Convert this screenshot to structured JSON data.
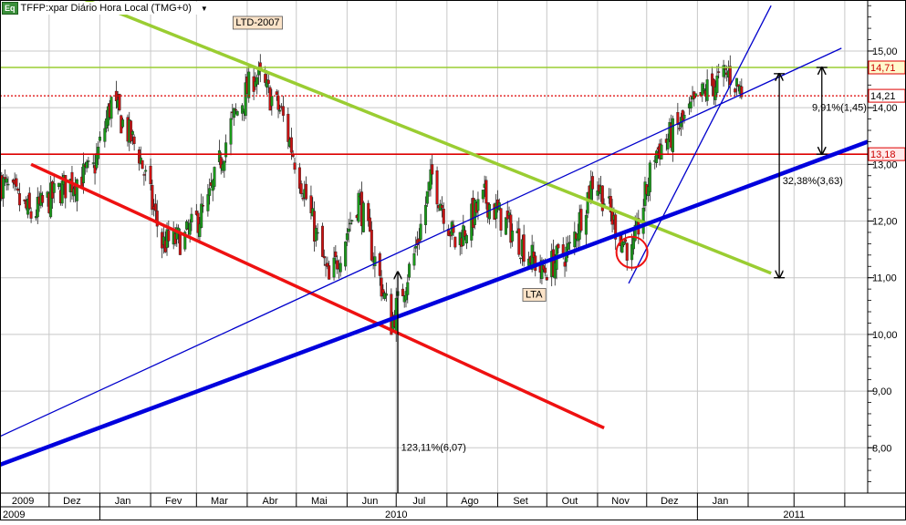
{
  "header": {
    "icon_label": "Eq",
    "title": "TFFP:xpar Diário Hora Local (TMG+0)",
    "dropdown_glyph": "▼"
  },
  "chart_data": {
    "type": "candlestick",
    "y_axis": {
      "position": "right",
      "range": [
        7.2,
        15.9
      ],
      "ticks": [
        "8,00",
        "9,00",
        "10,00",
        "11,00",
        "12,00",
        "13,00",
        "14,00",
        "15,00"
      ],
      "tick_values": [
        8,
        9,
        10,
        11,
        12,
        13,
        14,
        15
      ]
    },
    "x_axis": {
      "months": [
        {
          "label": "2009",
          "date": "2009-11-15"
        },
        {
          "label": "Dez",
          "date": "2009-12-15"
        },
        {
          "label": "Jan",
          "date": "2010-01-15"
        },
        {
          "label": "Fev",
          "date": "2010-02-15"
        },
        {
          "label": "Mar",
          "date": "2010-03-15"
        },
        {
          "label": "Abr",
          "date": "2010-04-15"
        },
        {
          "label": "Mai",
          "date": "2010-05-15"
        },
        {
          "label": "Jun",
          "date": "2010-06-15"
        },
        {
          "label": "Jul",
          "date": "2010-07-15"
        },
        {
          "label": "Ago",
          "date": "2010-08-15"
        },
        {
          "label": "Set",
          "date": "2010-09-15"
        },
        {
          "label": "Out",
          "date": "2010-10-15"
        },
        {
          "label": "Nov",
          "date": "2010-11-15"
        },
        {
          "label": "Dez",
          "date": "2010-12-15"
        },
        {
          "label": "Jan",
          "date": "2011-01-15"
        }
      ],
      "years": [
        {
          "label": "2009",
          "date": "2009-12-01"
        },
        {
          "label": "2010",
          "date": "2010-07-01"
        },
        {
          "label": "2011",
          "date": "2011-03-01"
        }
      ],
      "range": [
        "2009-11-01",
        "2011-04-15"
      ]
    },
    "price_anchors": [
      {
        "date": "2009-11-01",
        "close": 12.7
      },
      {
        "date": "2009-11-20",
        "close": 12.1
      },
      {
        "date": "2009-12-10",
        "close": 12.6
      },
      {
        "date": "2009-12-28",
        "close": 12.9
      },
      {
        "date": "2010-01-08",
        "close": 14.1
      },
      {
        "date": "2010-01-25",
        "close": 13.2
      },
      {
        "date": "2010-02-08",
        "close": 11.6
      },
      {
        "date": "2010-02-22",
        "close": 11.7
      },
      {
        "date": "2010-03-08",
        "close": 12.3
      },
      {
        "date": "2010-03-22",
        "close": 13.7
      },
      {
        "date": "2010-04-06",
        "close": 14.6
      },
      {
        "date": "2010-04-22",
        "close": 13.9
      },
      {
        "date": "2010-05-06",
        "close": 12.5
      },
      {
        "date": "2010-05-21",
        "close": 10.9
      },
      {
        "date": "2010-06-08",
        "close": 12.4
      },
      {
        "date": "2010-06-28",
        "close": 10.2
      },
      {
        "date": "2010-07-12",
        "close": 11.4
      },
      {
        "date": "2010-07-23",
        "close": 12.8
      },
      {
        "date": "2010-08-06",
        "close": 11.6
      },
      {
        "date": "2010-08-24",
        "close": 12.4
      },
      {
        "date": "2010-09-08",
        "close": 11.9
      },
      {
        "date": "2010-09-28",
        "close": 11.1
      },
      {
        "date": "2010-10-15",
        "close": 11.5
      },
      {
        "date": "2010-10-30",
        "close": 12.8
      },
      {
        "date": "2010-11-12",
        "close": 11.9
      },
      {
        "date": "2010-11-22",
        "close": 11.4
      },
      {
        "date": "2010-12-06",
        "close": 13.2
      },
      {
        "date": "2010-12-22",
        "close": 13.7
      },
      {
        "date": "2011-01-06",
        "close": 14.3
      },
      {
        "date": "2011-01-20",
        "close": 14.6
      },
      {
        "date": "2011-01-28",
        "close": 14.3
      }
    ],
    "horizontal_lines": [
      {
        "value": 14.71,
        "label": "14,71",
        "color": "#9acd32",
        "style": "solid"
      },
      {
        "value": 14.21,
        "label": "14,21",
        "color": "#dd0000",
        "style": "dotted"
      },
      {
        "value": 13.18,
        "label": "13,18",
        "color": "#dd0000",
        "style": "solid"
      }
    ],
    "trend_lines": [
      {
        "name": "LTD-2007",
        "color": "#9acd32",
        "from": {
          "date": "2009-12-15",
          "value": 16.0
        },
        "to": {
          "date": "2011-02-15",
          "value": 11.08
        }
      },
      {
        "name": "red-downtrend",
        "color": "#ee1111",
        "from": {
          "date": "2009-11-20",
          "value": 13.0
        },
        "to": {
          "date": "2010-11-05",
          "value": 8.35
        }
      },
      {
        "name": "LTA",
        "color": "#0000dd",
        "from": {
          "date": "2009-11-01",
          "value": 7.7
        },
        "to": {
          "date": "2011-04-15",
          "value": 13.4
        }
      },
      {
        "name": "upper-channel",
        "color": "#0000cc",
        "from": {
          "date": "2009-11-01",
          "value": 8.2
        },
        "to": {
          "date": "2011-03-30",
          "value": 15.05
        }
      },
      {
        "name": "steep-up",
        "color": "#0000cc",
        "from": {
          "date": "2010-11-20",
          "value": 10.9
        },
        "to": {
          "date": "2011-02-15",
          "value": 15.8
        }
      }
    ],
    "annotations": [
      {
        "text": "LTD-2007",
        "date": "2010-03-25",
        "value": 15.45,
        "box": true
      },
      {
        "text": "LTA",
        "date": "2010-09-18",
        "value": 10.65,
        "box": true
      },
      {
        "text": "9,91%(1,45)",
        "date": "2011-03-12",
        "value": 13.95,
        "box": false
      },
      {
        "text": "32,38%(3,63)",
        "date": "2011-02-22",
        "value": 12.65,
        "box": false
      },
      {
        "text": "123,11%(6,07)",
        "date": "2010-07-04",
        "value": 7.95,
        "box": false
      }
    ],
    "measure_arrows": [
      {
        "date": "2011-02-20",
        "from": 11.0,
        "to": 14.6,
        "double": true
      },
      {
        "date": "2011-03-18",
        "from": 13.18,
        "to": 14.71,
        "double": true
      },
      {
        "date": "2010-07-02",
        "from": 7.2,
        "to": 11.1,
        "double": false
      }
    ],
    "circle_marker": {
      "date": "2010-11-22",
      "value": 11.45,
      "color": "#ee1111"
    }
  }
}
